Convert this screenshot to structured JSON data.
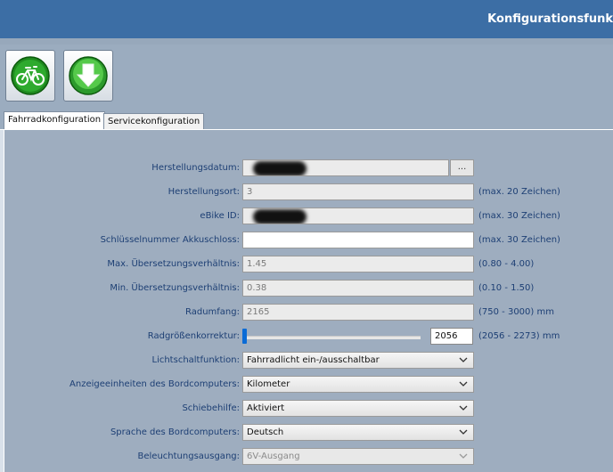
{
  "window": {
    "title": "Konfigurationsfunk"
  },
  "toolbar": {
    "buttons": [
      {
        "icon": "bicycle-icon"
      },
      {
        "icon": "download-arrow-icon"
      }
    ]
  },
  "tabs": [
    {
      "label": "Fahrradkonfiguration",
      "active": true
    },
    {
      "label": "Servicekonfiguration",
      "active": false
    }
  ],
  "form": {
    "herstellungsdatum": {
      "label": "Herstellungsdatum:",
      "value": "",
      "button": "..."
    },
    "herstellungsort": {
      "label": "Herstellungsort:",
      "value": "3",
      "hint": "(max. 20 Zeichen)"
    },
    "ebike_id": {
      "label": "eBike ID:",
      "value": "",
      "hint": "(max. 30 Zeichen)"
    },
    "schluessel": {
      "label": "Schlüsselnummer Akkuschloss:",
      "value": "",
      "hint": "(max. 30 Zeichen)"
    },
    "max_uebersetzung": {
      "label": "Max. Übersetzungsverhältnis:",
      "value": "1.45",
      "hint": "(0.80 - 4.00)"
    },
    "min_uebersetzung": {
      "label": "Min. Übersetzungsverhältnis:",
      "value": "0.38",
      "hint": "(0.10 - 1.50)"
    },
    "radumfang": {
      "label": "Radumfang:",
      "value": "2165",
      "hint": "(750 - 3000) mm"
    },
    "radgroesse": {
      "label": "Radgrößenkorrektur:",
      "value": "2056",
      "min": 2056,
      "max": 2273,
      "hint": "(2056 - 2273) mm"
    },
    "lichtschalt": {
      "label": "Lichtschaltfunktion:",
      "value": "Fahrradlicht ein-/ausschaltbar"
    },
    "anzeigeeinheiten": {
      "label": "Anzeigeeinheiten des Bordcomputers:",
      "value": "Kilometer"
    },
    "schiebehilfe": {
      "label": "Schiebehilfe:",
      "value": "Aktiviert"
    },
    "sprache": {
      "label": "Sprache des Bordcomputers:",
      "value": "Deutsch"
    },
    "beleuchtung": {
      "label": "Beleuchtungsausgang:",
      "value": "6V-Ausgang"
    }
  },
  "colors": {
    "titlebar": "#3c6ea5",
    "panel": "#9eadbf",
    "label": "#1d3f74",
    "slider_thumb": "#0a6bd6"
  }
}
